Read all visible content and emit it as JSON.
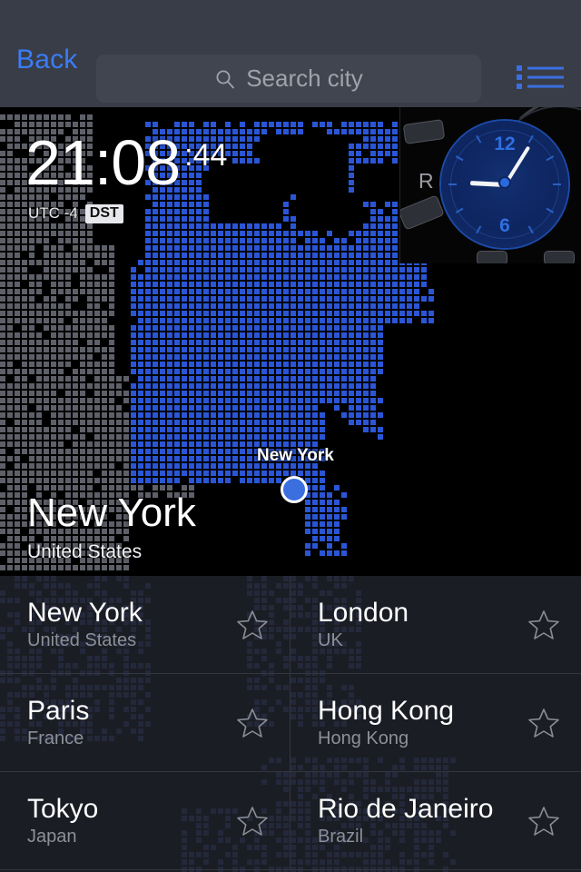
{
  "header": {
    "back_label": "Back",
    "search_placeholder": "Search city",
    "search_value": "",
    "search_icon": "search-icon",
    "list_icon": "list-view-icon",
    "accent_color": "#3b7cf6"
  },
  "map": {
    "clock": {
      "time": "21:08",
      "seconds": ":44",
      "utc_offset": "UTC -4",
      "dst_badge": "DST"
    },
    "analog_widget": {
      "numeral_top": "12",
      "numeral_bottom": "6",
      "gear_label": "R"
    },
    "marker": {
      "label": "New York"
    },
    "overlay": {
      "city": "New York",
      "country": "United States"
    },
    "colors": {
      "dot_highlight": "#2a56d6",
      "dot_inactive": "#5e6069",
      "marker": "#3b6fe0"
    }
  },
  "city_list": {
    "star_icon": "star-outline-icon",
    "items": [
      {
        "city": "New York",
        "country": "United States"
      },
      {
        "city": "London",
        "country": "UK"
      },
      {
        "city": "Paris",
        "country": "France"
      },
      {
        "city": "Hong Kong",
        "country": "Hong Kong"
      },
      {
        "city": "Tokyo",
        "country": "Japan"
      },
      {
        "city": "Rio de Janeiro",
        "country": "Brazil"
      }
    ]
  }
}
